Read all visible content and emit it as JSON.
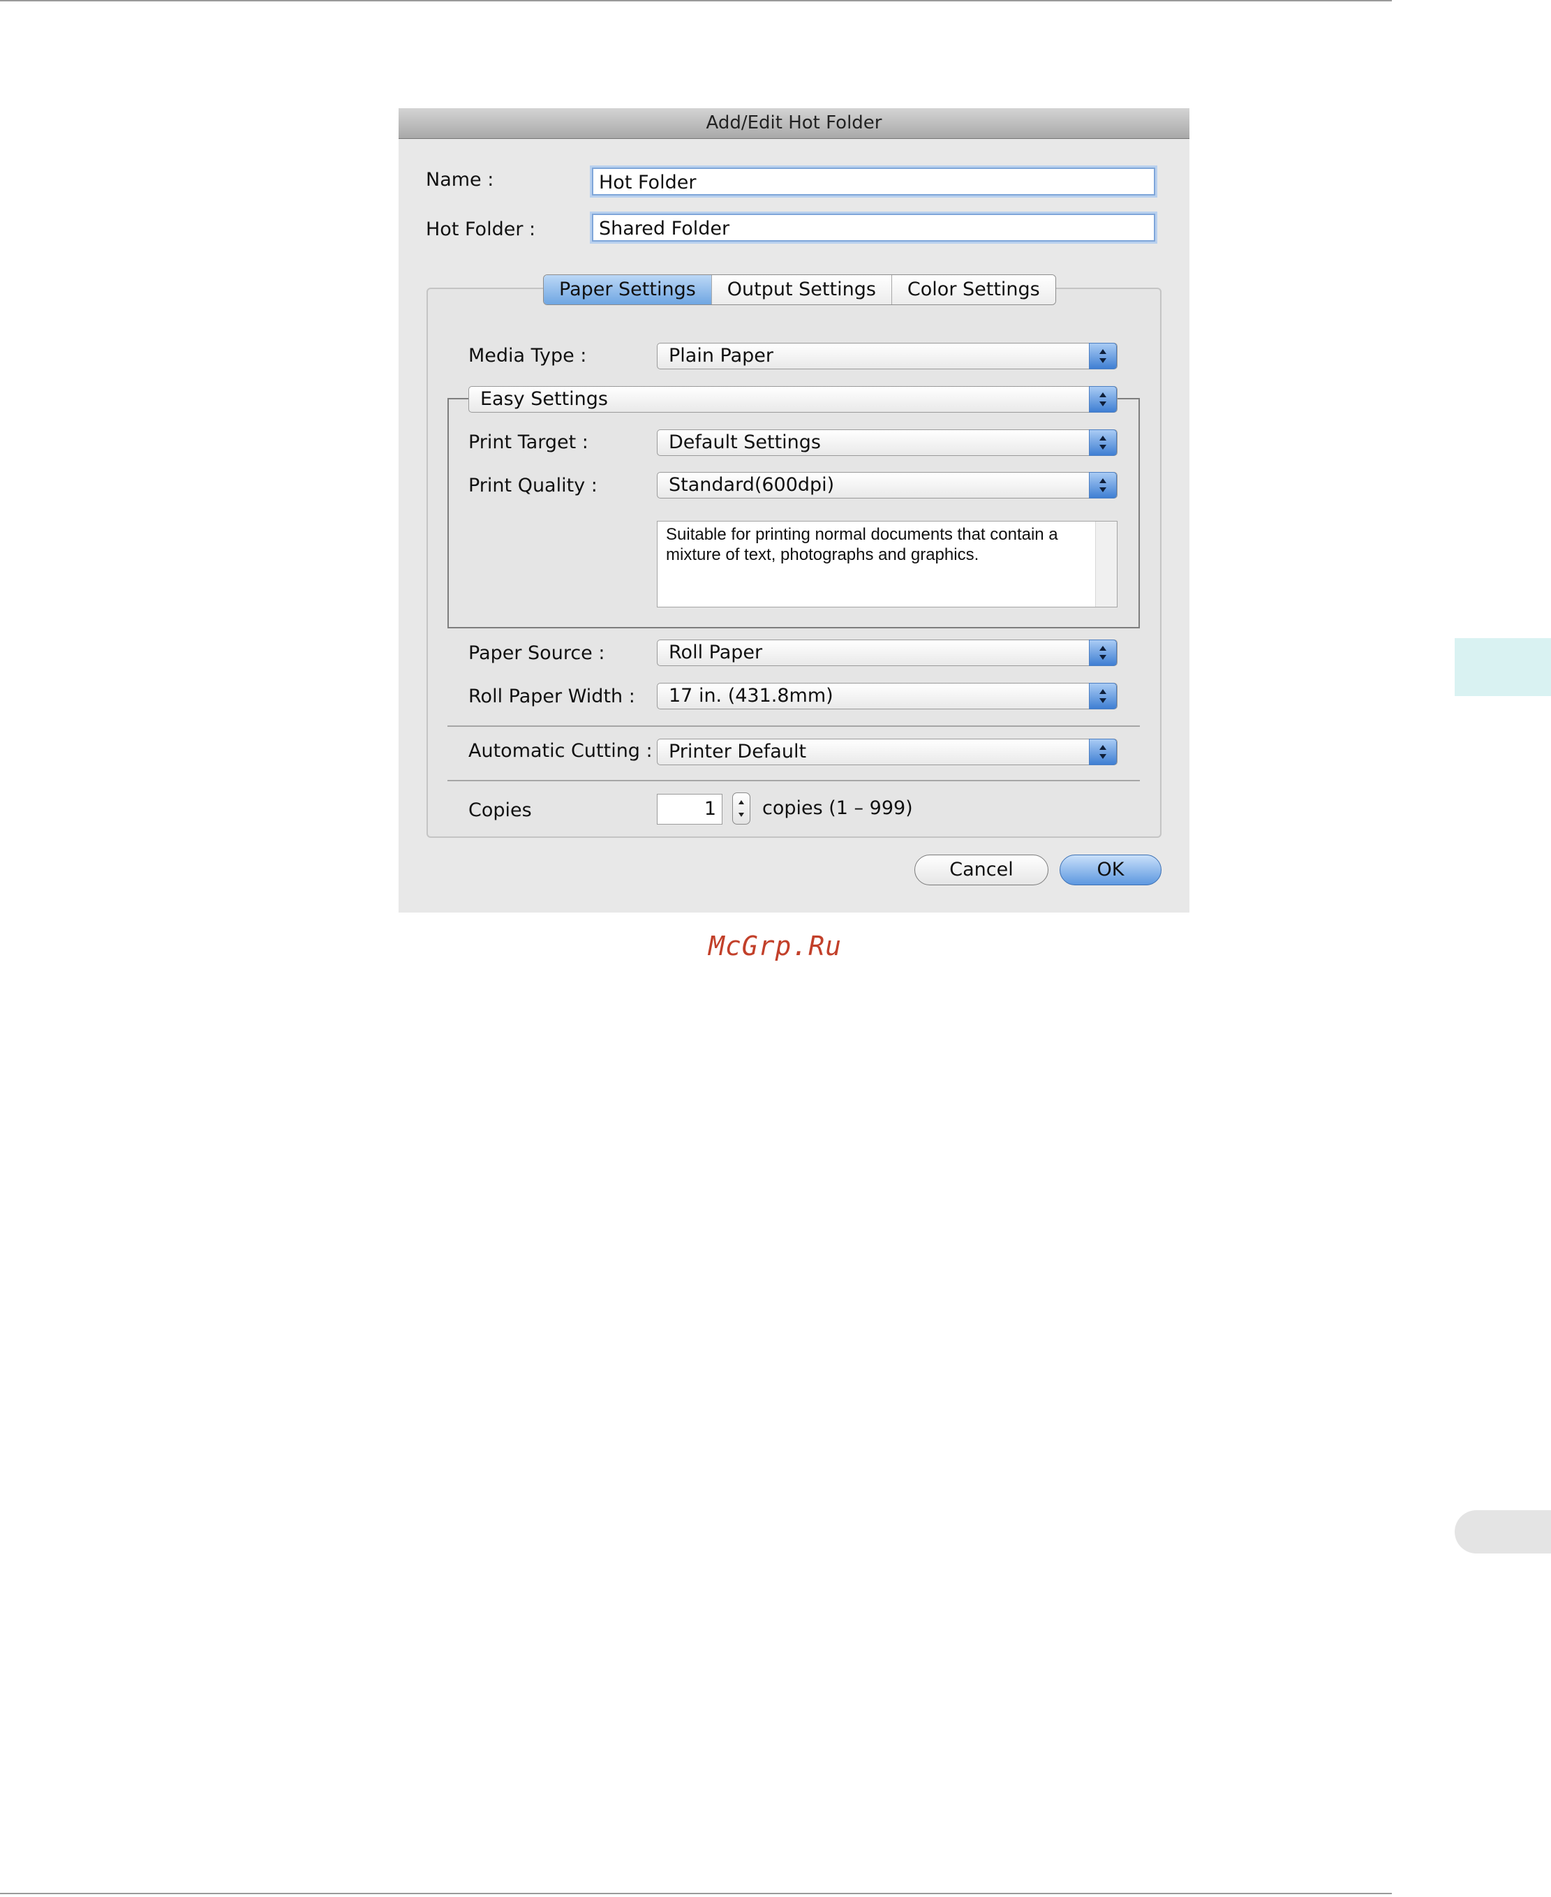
{
  "dialog": {
    "title": "Add/Edit Hot Folder",
    "name_label": "Name :",
    "name_value": "Hot Folder",
    "hot_folder_label": "Hot Folder :",
    "hot_folder_value": "Shared Folder"
  },
  "tabs": [
    {
      "label": "Paper Settings",
      "active": true
    },
    {
      "label": "Output Settings",
      "active": false
    },
    {
      "label": "Color Settings",
      "active": false
    }
  ],
  "paper": {
    "media_type_label": "Media Type :",
    "media_type_value": "Plain Paper",
    "easy_settings_value": "Easy Settings",
    "print_target_label": "Print Target :",
    "print_target_value": "Default Settings",
    "print_quality_label": "Print Quality :",
    "print_quality_value": "Standard(600dpi)",
    "description": "Suitable for printing normal documents that contain a mixture of text, photographs and graphics.",
    "paper_source_label": "Paper Source :",
    "paper_source_value": "Roll Paper",
    "roll_width_label": "Roll Paper Width :",
    "roll_width_value": "17 in. (431.8mm)",
    "auto_cut_label": "Automatic Cutting :",
    "auto_cut_value": "Printer Default",
    "copies_label": "Copies",
    "copies_value": "1",
    "copies_range": "copies (1 – 999)"
  },
  "buttons": {
    "cancel": "Cancel",
    "ok": "OK"
  },
  "watermark": "McGrp.Ru",
  "colors": {
    "accent": "#5d98e0",
    "side_tab": "#d9f2f2",
    "watermark": "#c2402a"
  }
}
